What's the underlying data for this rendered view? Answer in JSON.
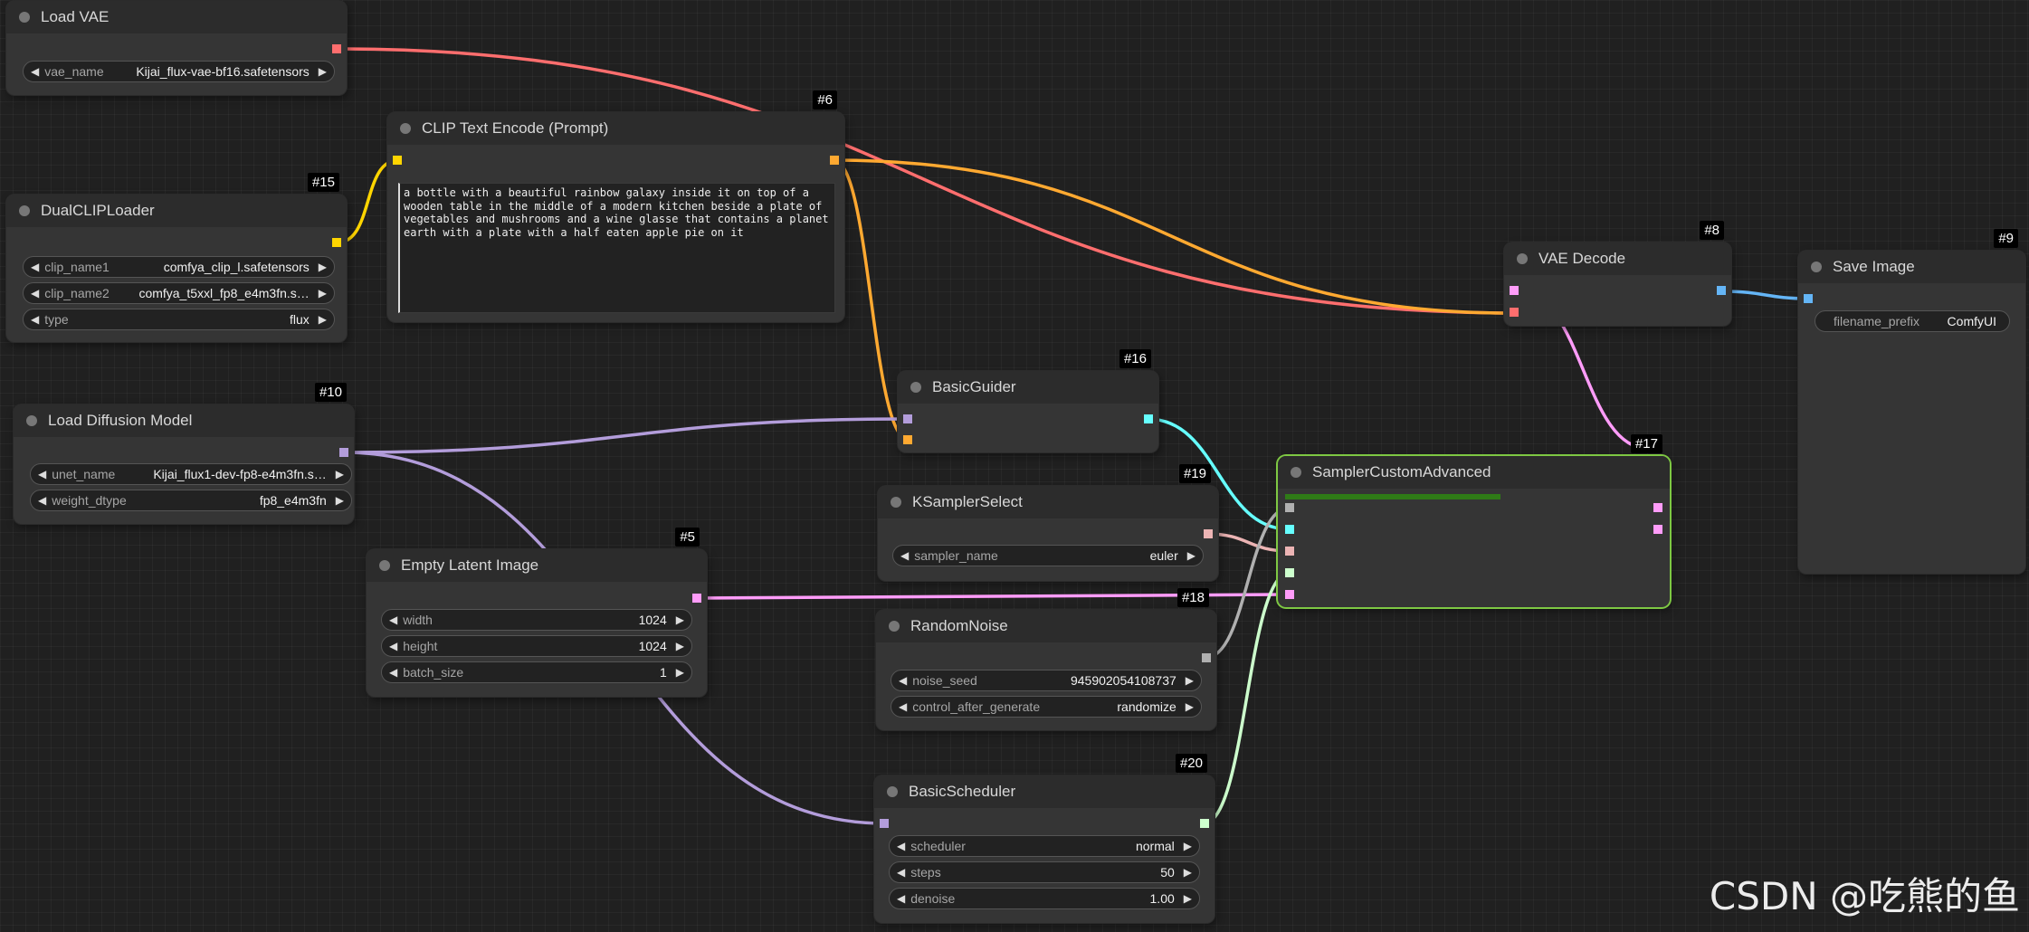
{
  "colors": {
    "vae": "#ff6e6e",
    "clip": "#ffd500",
    "conditioning": "#ffa931",
    "model": "#b39ddb",
    "latent": "#ff9cf9",
    "noise": "#b0b0b0",
    "sampler": "#ecb4b4",
    "sigmas": "#cdffcd",
    "guider": "#66ffff",
    "image": "#64b5f6",
    "selected_border": "#7ec843"
  },
  "nodes": {
    "load_vae": {
      "title": "Load VAE",
      "widgets": [
        {
          "label": "vae_name",
          "value": "Kijai_flux-vae-bf16.safetensors"
        }
      ]
    },
    "dual_clip_loader": {
      "id": "#15",
      "title": "DualCLIPLoader",
      "widgets": [
        {
          "label": "clip_name1",
          "value": "comfya_clip_l.safetensors"
        },
        {
          "label": "clip_name2",
          "value": "comfya_t5xxl_fp8_e4m3fn.s…"
        },
        {
          "label": "type",
          "value": "flux"
        }
      ]
    },
    "clip_text_encode": {
      "id": "#6",
      "title": "CLIP Text Encode (Prompt)",
      "text": "a bottle with a beautiful rainbow galaxy inside it on top of a wooden table in the middle of a modern kitchen beside a plate of vegetables and mushrooms and a wine glasse that contains a planet earth with a plate with a half eaten apple pie on it"
    },
    "load_diffusion_model": {
      "id": "#10",
      "title": "Load Diffusion Model",
      "widgets": [
        {
          "label": "unet_name",
          "value": "Kijai_flux1-dev-fp8-e4m3fn.s…"
        },
        {
          "label": "weight_dtype",
          "value": "fp8_e4m3fn"
        }
      ]
    },
    "empty_latent_image": {
      "id": "#5",
      "title": "Empty Latent Image",
      "widgets": [
        {
          "label": "width",
          "value": "1024"
        },
        {
          "label": "height",
          "value": "1024"
        },
        {
          "label": "batch_size",
          "value": "1"
        }
      ]
    },
    "basic_guider": {
      "id": "#16",
      "title": "BasicGuider"
    },
    "ksampler_select": {
      "id": "#19",
      "title": "KSamplerSelect",
      "widgets": [
        {
          "label": "sampler_name",
          "value": "euler"
        }
      ]
    },
    "random_noise": {
      "id": "#18",
      "title": "RandomNoise",
      "widgets": [
        {
          "label": "noise_seed",
          "value": "945902054108737"
        },
        {
          "label": "control_after_generate",
          "value": "randomize"
        }
      ]
    },
    "basic_scheduler": {
      "id": "#20",
      "title": "BasicScheduler",
      "widgets": [
        {
          "label": "scheduler",
          "value": "normal"
        },
        {
          "label": "steps",
          "value": "50"
        },
        {
          "label": "denoise",
          "value": "1.00"
        }
      ]
    },
    "sampler_custom_advanced": {
      "id": "#17",
      "title": "SamplerCustomAdvanced"
    },
    "vae_decode": {
      "id": "#8",
      "title": "VAE Decode"
    },
    "save_image": {
      "id": "#9",
      "title": "Save Image",
      "widgets": [
        {
          "label": "filename_prefix",
          "value": "ComfyUI"
        }
      ]
    }
  },
  "watermark": "CSDN @吃熊的鱼"
}
